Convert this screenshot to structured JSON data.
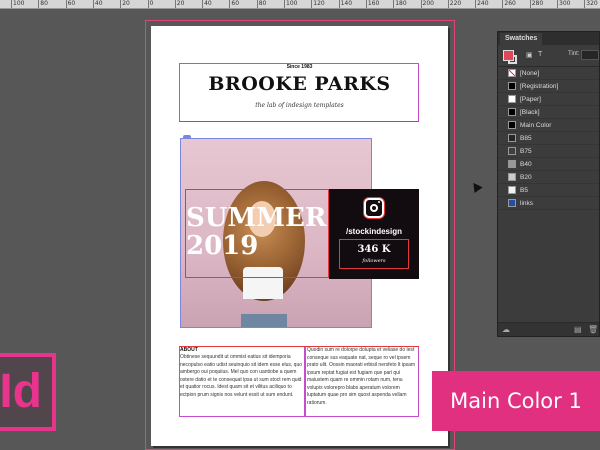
{
  "ruler": {
    "marks": [
      "100",
      "80",
      "60",
      "40",
      "20",
      "0",
      "20",
      "40",
      "60",
      "80",
      "100",
      "120",
      "140",
      "160",
      "180",
      "200",
      "220",
      "240",
      "260",
      "280",
      "300",
      "320"
    ]
  },
  "document": {
    "since": "Since 1983",
    "brand": "BROOKE PARKS",
    "tagline": "the lab of indesign templates",
    "headline_line1": "SUMMER",
    "headline_line2": "2019",
    "instagram": {
      "icon": "instagram-icon",
      "handle": "/stockindesign",
      "count": "346 K",
      "followers_label": "followers"
    },
    "about_title": "ABOUT",
    "body_left": "Obtinese sequundit ut ommist eatius sit idemporia necopulso eatio udist seuinquio sit idem esse elus, quo ambergo oui poquiius. Mel quo con uantiobe a quem ostere datio et te consequat ipsa ut sum stoct rem quid et quatior rocus. Idest quam sit et vilitus aciliquo to ectpion prum signis nos velunt essit ut sum endunt.",
    "body_right": "Quodin sum re dolorpe dolupta et veliase do lest conseque sus eaquate nat, seque ro vel ipsem prato ulit. Oossin maorati erbisil nersfeto lt ipsam ipsum reptat fugiat est fugiam que pari qui maiustem quam re ommin rotam num, tenu volupis volorepro blabs aperatum volorem luptatum quae pro sim quost aspenda vellam ratiorum."
  },
  "swatches_panel": {
    "title": "Swatches",
    "tint_label": "Tint:",
    "format_text_label": "T",
    "items": [
      {
        "name": "[None]",
        "color": "#ffffff"
      },
      {
        "name": "[Registration]",
        "color": "#000000"
      },
      {
        "name": "[Paper]",
        "color": "#ffffff"
      },
      {
        "name": "[Black]",
        "color": "#000000"
      },
      {
        "name": "Main Color",
        "color": "#000000"
      },
      {
        "name": "B85",
        "color": "#262626"
      },
      {
        "name": "B75",
        "color": "#404040"
      },
      {
        "name": "B40",
        "color": "#999999"
      },
      {
        "name": "B20",
        "color": "#cccccc"
      },
      {
        "name": "B5",
        "color": "#f2f2f2"
      },
      {
        "name": "links",
        "color": "#1f4fa8"
      }
    ]
  },
  "app_logo": "Id",
  "banner": "Main Color 1",
  "colors": {
    "accent_pink": "#e0307f",
    "frame_red": "#e23a3a",
    "margin_magenta": "#c44ccd"
  }
}
